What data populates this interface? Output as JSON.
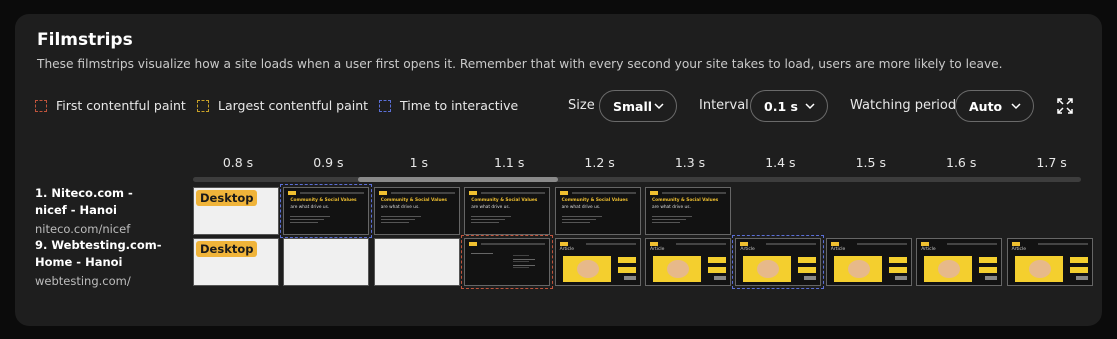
{
  "header": {
    "title": "Filmstrips",
    "description": "These filmstrips visualize how a site loads when a user first opens it. Remember that with every second your site takes to load, users are more likely to leave."
  },
  "legend": [
    {
      "label": "First contentful paint",
      "color": "#c0543c"
    },
    {
      "label": "Largest contentful paint",
      "color": "#c9a227"
    },
    {
      "label": "Time to interactive",
      "color": "#5b6fd6"
    }
  ],
  "controls": {
    "size": {
      "label": "Size",
      "value": "Small"
    },
    "interval": {
      "label": "Interval",
      "value": "0.1 s"
    },
    "watching_period": {
      "label": "Watching period",
      "value": "Auto"
    }
  },
  "timeline": [
    "0.8 s",
    "0.9 s",
    "1 s",
    "1.1 s",
    "1.2 s",
    "1.3 s",
    "1.4 s",
    "1.5 s",
    "1.6 s",
    "1.7 s"
  ],
  "sites": [
    {
      "name": "1. Niteco.com - nicef - Hanoi",
      "url": "niteco.com/nicef",
      "device": "Desktop",
      "frames": [
        "blank",
        "niteco",
        "niteco",
        "niteco",
        "niteco",
        "niteco"
      ],
      "highlights": {
        "1": "tti"
      },
      "frame_headline": "Community & Social Values",
      "frame_subline": "are what drive us."
    },
    {
      "name": "9. Webtesting.com- Home - Hanoi",
      "url": "webtesting.com/",
      "device": "Desktop",
      "frames": [
        "blank",
        "blank",
        "blank",
        "darktext",
        "article",
        "article",
        "article",
        "article",
        "article",
        "article"
      ],
      "highlights": {
        "3": "fcp",
        "6": "tti"
      },
      "frame_label": "Article"
    }
  ]
}
